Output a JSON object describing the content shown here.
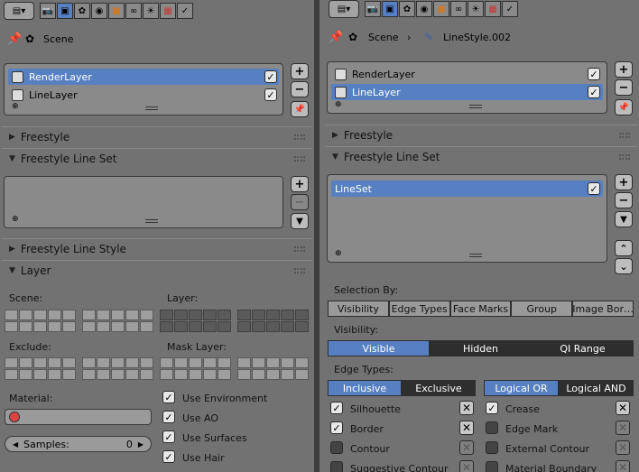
{
  "left": {
    "breadcrumb": {
      "scene": "Scene"
    },
    "render_layers": [
      {
        "label": "RenderLayer",
        "checked": true,
        "selected": true
      },
      {
        "label": "LineLayer",
        "checked": true,
        "selected": false
      }
    ],
    "sections": {
      "freestyle": "Freestyle",
      "freestyle_line_set": "Freestyle Line Set",
      "freestyle_line_style": "Freestyle Line Style",
      "layer": "Layer"
    },
    "layer_panel": {
      "scene_label": "Scene:",
      "layer_label": "Layer:",
      "exclude_label": "Exclude:",
      "mask_layer_label": "Mask Layer:",
      "material_label": "Material:",
      "samples_label": "Samples:",
      "samples_value": "0",
      "options": [
        {
          "label": "Use Environment",
          "checked": true
        },
        {
          "label": "Use AO",
          "checked": true
        },
        {
          "label": "Use Surfaces",
          "checked": true
        },
        {
          "label": "Use Hair",
          "checked": true
        }
      ]
    }
  },
  "right": {
    "breadcrumb": {
      "scene": "Scene",
      "separator": "›",
      "linestyle": "LineStyle.002"
    },
    "render_layers": [
      {
        "label": "RenderLayer",
        "checked": true,
        "selected": false
      },
      {
        "label": "LineLayer",
        "checked": true,
        "selected": true
      }
    ],
    "sections": {
      "freestyle": "Freestyle",
      "freestyle_line_set": "Freestyle Line Set"
    },
    "line_sets": [
      {
        "label": "LineSet",
        "checked": true,
        "selected": true
      }
    ],
    "selection_by": {
      "label": "Selection By:",
      "tabs": [
        "Visibility",
        "Edge Types",
        "Face Marks",
        "Group",
        "Image Bor…"
      ]
    },
    "visibility": {
      "label": "Visibility:",
      "options": [
        "Visible",
        "Hidden",
        "QI Range"
      ],
      "active": "Visible"
    },
    "edge_types": {
      "label": "Edge Types:",
      "mode": [
        "Inclusive",
        "Exclusive"
      ],
      "active_mode": "Inclusive",
      "logic": [
        "Logical OR",
        "Logical AND"
      ],
      "active_logic": "Logical OR",
      "left_column": [
        {
          "label": "Silhouette",
          "checked": true
        },
        {
          "label": "Border",
          "checked": true
        },
        {
          "label": "Contour",
          "checked": false
        },
        {
          "label": "Suggestive Contour",
          "checked": false
        }
      ],
      "right_column": [
        {
          "label": "Crease",
          "checked": true
        },
        {
          "label": "Edge Mark",
          "checked": false
        },
        {
          "label": "External Contour",
          "checked": false
        },
        {
          "label": "Material Boundary",
          "checked": false
        }
      ]
    }
  },
  "colors": {
    "selection": "#5680c2",
    "panel": "#727272"
  },
  "icons": [
    "editor-type-icon",
    "render-icon",
    "render-layer-icon",
    "scene-icon",
    "world-icon",
    "object-icon",
    "constraint-icon",
    "modifier-icon",
    "texture-icon",
    "physics-icon",
    "pin-icon",
    "plus-icon",
    "minus-icon",
    "linestyle-icon"
  ]
}
